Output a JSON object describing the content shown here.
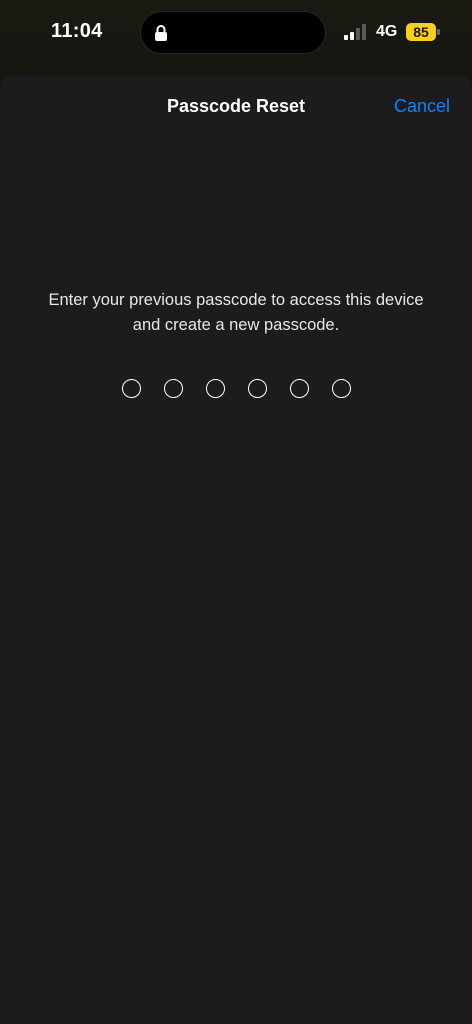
{
  "status_bar": {
    "time": "11:04",
    "network": "4G",
    "battery": "85",
    "signal_icon": "signal-bars-icon",
    "lock_icon": "lock-icon"
  },
  "nav": {
    "title": "Passcode Reset",
    "cancel_label": "Cancel"
  },
  "instructions": {
    "line1": "Enter your previous passcode to access this device",
    "line2": "and create a new passcode."
  },
  "passcode": {
    "length": 6,
    "entered": 0
  },
  "colors": {
    "accent": "#0a84ff",
    "sheet_bg": "#1c1c1e",
    "battery": "#f5d020"
  }
}
